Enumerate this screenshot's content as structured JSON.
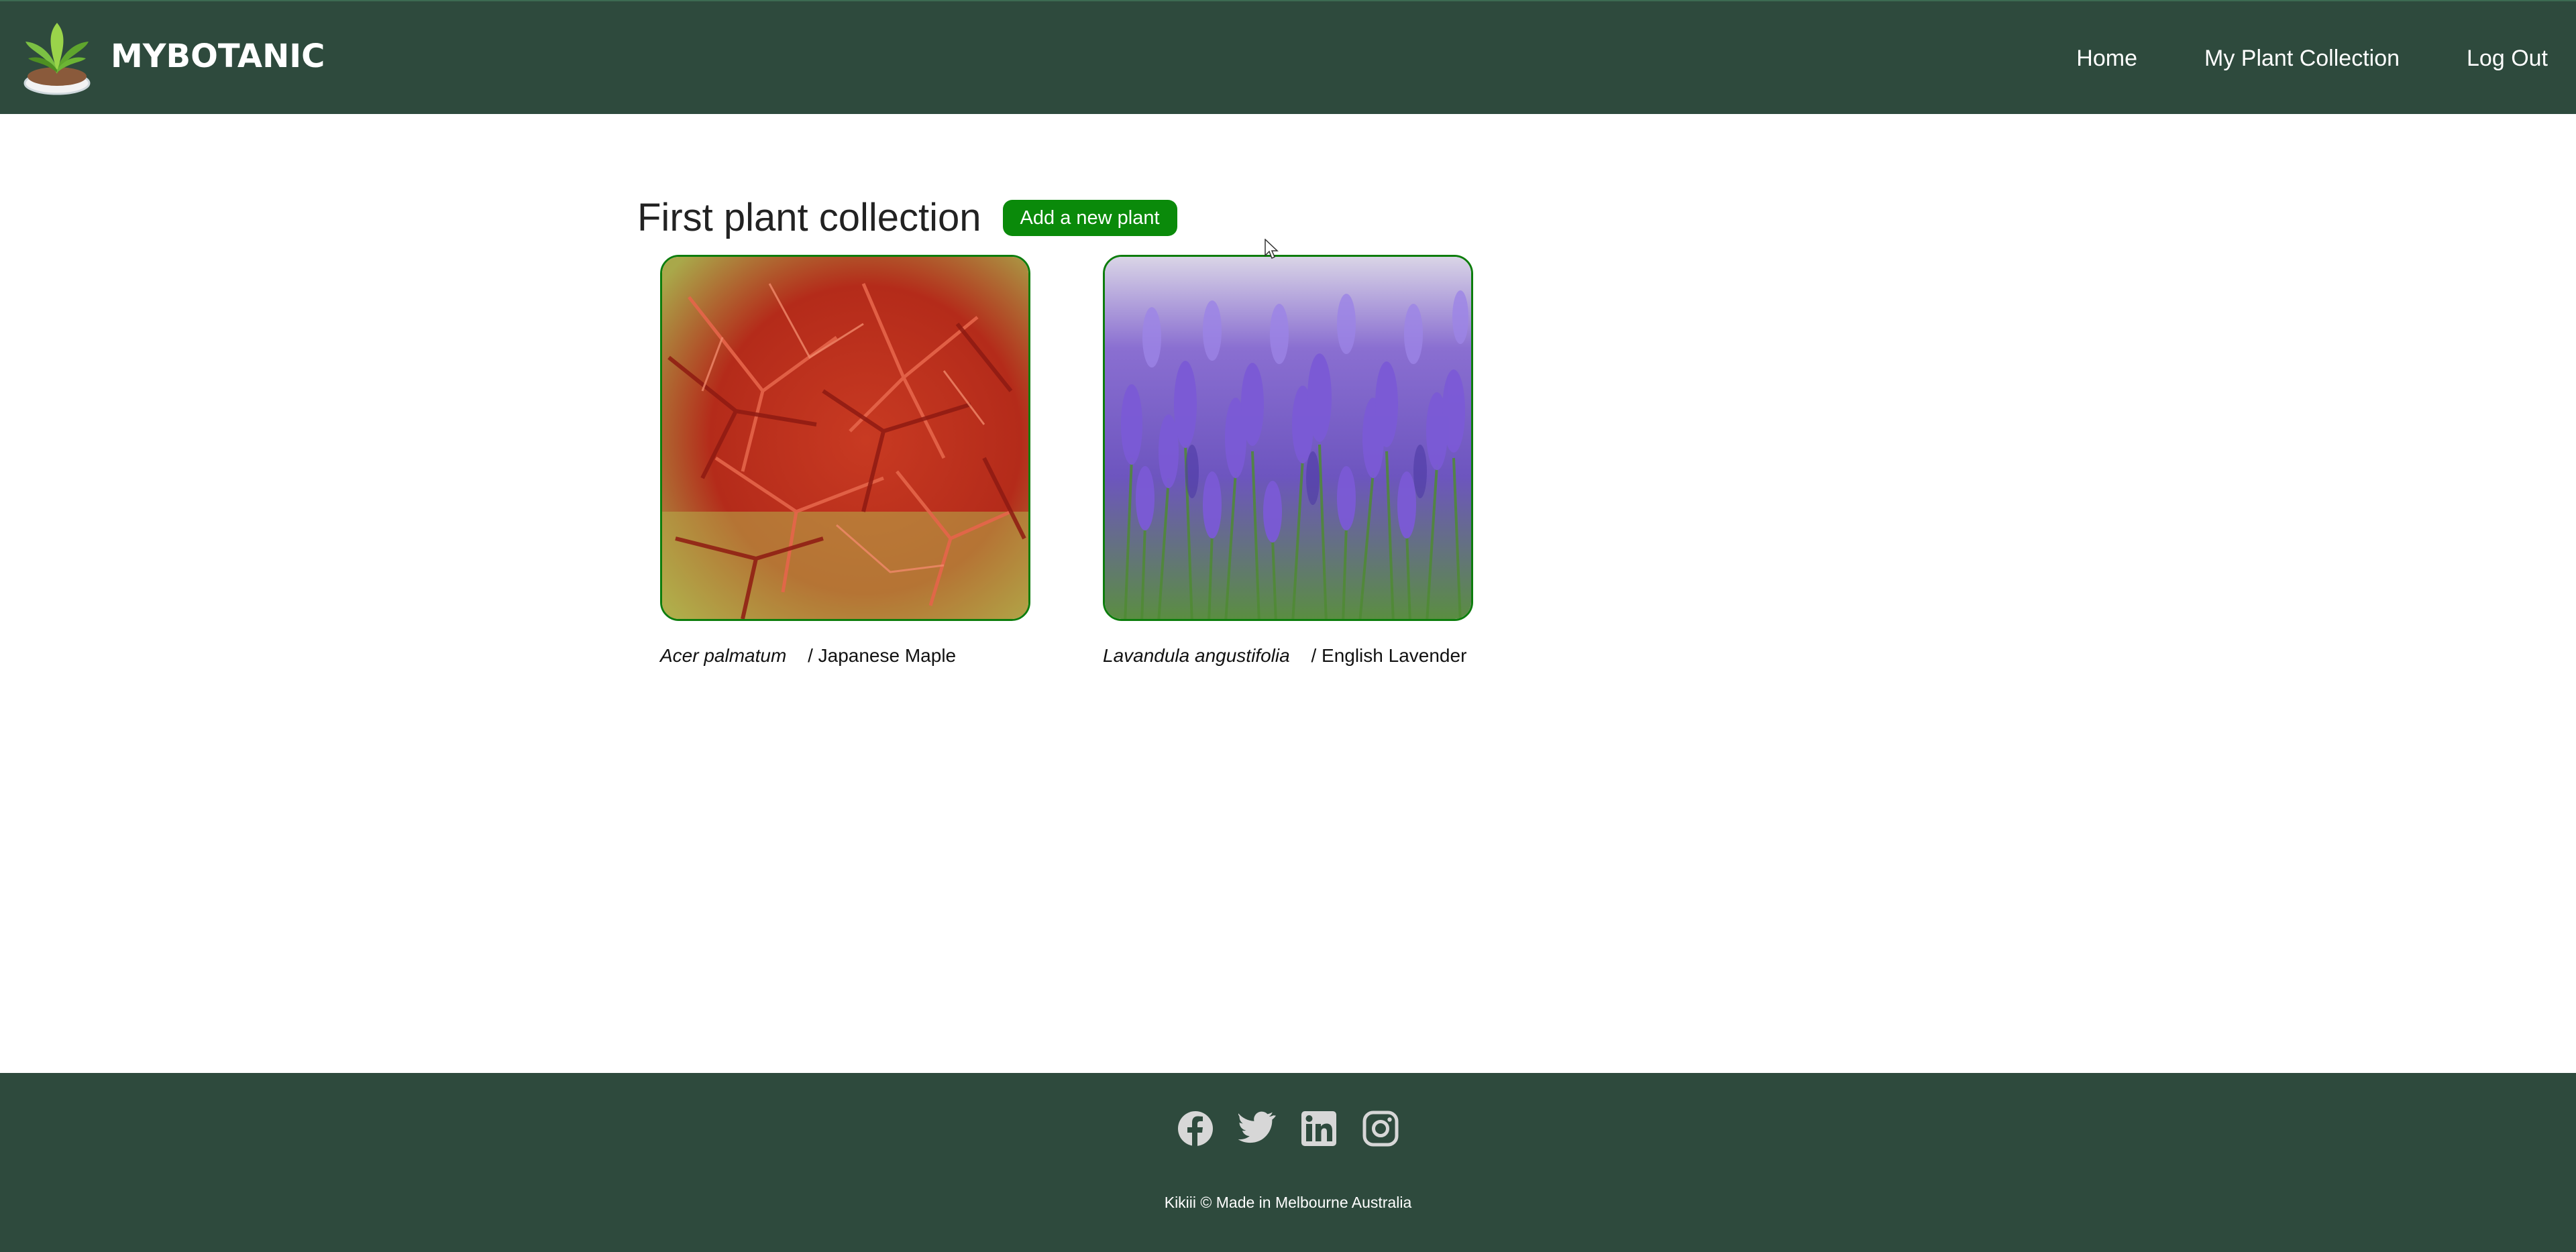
{
  "header": {
    "brand": "MYBOTANIC",
    "logo_icon": "potted-plant-icon",
    "nav": [
      {
        "label": "Home"
      },
      {
        "label": "My Plant Collection"
      },
      {
        "label": "Log Out"
      }
    ]
  },
  "main": {
    "title": "First plant collection",
    "add_button_label": "Add a new plant",
    "plants": [
      {
        "scientific_name": "Acer palmatum",
        "separator": "/",
        "common_name": "Japanese Maple",
        "image": "red-maple-leaves-photo"
      },
      {
        "scientific_name": "Lavandula angustifolia",
        "separator": "/",
        "common_name": "English Lavender",
        "image": "purple-lavender-field-photo"
      }
    ]
  },
  "footer": {
    "social_icons": [
      "facebook-icon",
      "twitter-icon",
      "linkedin-icon",
      "instagram-icon"
    ],
    "credit": "Kikiii © Made in Melbourne Australia"
  },
  "colors": {
    "header_bg": "#2e4a3d",
    "footer_bg": "#2e4a3d",
    "button_bg": "#0a8a0a",
    "card_border": "#0d7d0d"
  }
}
